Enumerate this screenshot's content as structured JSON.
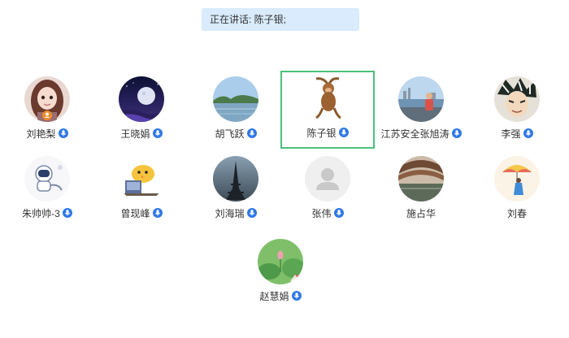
{
  "speaking": {
    "text": "正在讲话: 陈子银;"
  },
  "participants": [
    {
      "name": "刘艳梨",
      "avatar": "anime-girl-avatar",
      "mic": true,
      "active": false
    },
    {
      "name": "王晓娟",
      "avatar": "night-moon-avatar",
      "mic": true,
      "active": false
    },
    {
      "name": "胡飞跃",
      "avatar": "lake-landscape-avatar",
      "mic": true,
      "active": false
    },
    {
      "name": "陈子银",
      "avatar": "monkey-avatar",
      "mic": true,
      "active": true
    },
    {
      "name": "江苏安全张旭涛",
      "avatar": "lakeside-person-avatar",
      "mic": true,
      "active": false
    },
    {
      "name": "李强",
      "avatar": "anime-character-avatar",
      "mic": true,
      "active": false
    },
    {
      "name": "朱帅帅-3",
      "avatar": "astronaut-avatar",
      "mic": true,
      "active": false
    },
    {
      "name": "曾现峰",
      "avatar": "cartoon-chick-avatar",
      "mic": true,
      "active": false
    },
    {
      "name": "刘海瑞",
      "avatar": "eiffel-tower-avatar",
      "mic": true,
      "active": false
    },
    {
      "name": "张伟",
      "avatar": "default-user-avatar",
      "mic": true,
      "active": false
    },
    {
      "name": "施占华",
      "avatar": "architecture-avatar",
      "mic": false,
      "active": false
    },
    {
      "name": "刘春",
      "avatar": "umbrella-girl-avatar",
      "mic": false,
      "active": false
    },
    {
      "name": "赵慧娟",
      "avatar": "lotus-pond-avatar",
      "mic": true,
      "active": false
    }
  ],
  "colors": {
    "speaking_bg": "#d9ebfd",
    "active_border": "#4cc07a",
    "mic_badge": "#2f78e6"
  }
}
